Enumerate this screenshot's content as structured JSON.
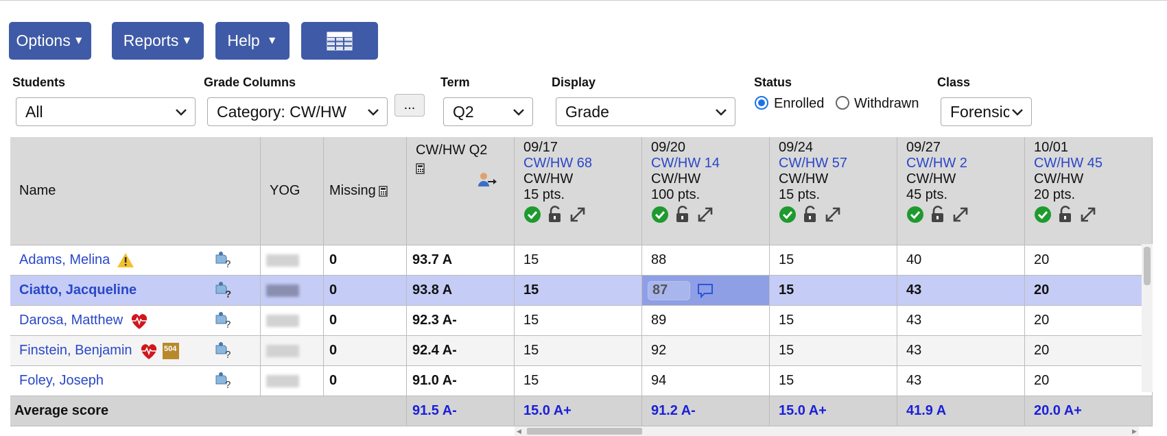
{
  "toolbar": {
    "options_label": "Options",
    "reports_label": "Reports",
    "help_label": "Help",
    "grid_view_icon": "grid-icon"
  },
  "filters": {
    "students_label": "Students",
    "students_value": "All",
    "grade_columns_label": "Grade Columns",
    "grade_columns_value": "Category: CW/HW",
    "more_label": "...",
    "term_label": "Term",
    "term_value": "Q2",
    "display_label": "Display",
    "display_value": "Grade",
    "status_label": "Status",
    "status_enrolled": "Enrolled",
    "status_withdrawn": "Withdrawn",
    "class_label": "Class",
    "class_value": "Forensic"
  },
  "grid": {
    "headers": {
      "name": "Name",
      "yog": "YOG",
      "missing": "Missing",
      "term_avg": "CW/HW Q2"
    },
    "assignments": [
      {
        "date": "09/17",
        "title": "CW/HW 68",
        "category": "CW/HW",
        "points": "15 pts."
      },
      {
        "date": "09/20",
        "title": "CW/HW 14",
        "category": "CW/HW",
        "points": "100 pts."
      },
      {
        "date": "09/24",
        "title": "CW/HW 57",
        "category": "CW/HW",
        "points": "15 pts."
      },
      {
        "date": "09/27",
        "title": "CW/HW 2",
        "category": "CW/HW",
        "points": "45 pts."
      },
      {
        "date": "10/01",
        "title": "CW/HW 45",
        "category": "CW/HW",
        "points": "20 pts."
      }
    ],
    "rows": [
      {
        "name": "Adams, Melina",
        "flags": [
          "warning-icon"
        ],
        "missing": "0",
        "avg": "93.7 A",
        "scores": [
          "15",
          "88",
          "15",
          "40",
          "20"
        ]
      },
      {
        "name": "Ciatto, Jacqueline",
        "flags": [],
        "missing": "0",
        "avg": "93.8 A",
        "scores": [
          "15",
          "87",
          "15",
          "43",
          "20"
        ],
        "selected": true
      },
      {
        "name": "Darosa, Matthew",
        "flags": [
          "health-heart-icon"
        ],
        "missing": "0",
        "avg": "92.3 A-",
        "scores": [
          "15",
          "89",
          "15",
          "43",
          "20"
        ]
      },
      {
        "name": "Finstein, Benjamin",
        "flags": [
          "health-heart-icon",
          "504-plan-icon"
        ],
        "missing": "0",
        "avg": "92.4 A-",
        "scores": [
          "15",
          "92",
          "15",
          "43",
          "20"
        ]
      },
      {
        "name": "Foley, Joseph",
        "flags": [],
        "missing": "0",
        "avg": "91.0 A-",
        "scores": [
          "15",
          "94",
          "15",
          "43",
          "20"
        ]
      }
    ],
    "average": {
      "label": "Average score",
      "avg": "91.5 A-",
      "scores": [
        "15.0 A+",
        "91.2 A-",
        "15.0 A+",
        "41.9 A",
        "20.0 A+"
      ]
    },
    "badge_504": "504"
  },
  "colors": {
    "button_bg": "#3f5aa6",
    "link": "#2a47c8",
    "selected_row": "#c5cdf6",
    "avg_text": "#1a1fd8",
    "check_green": "#1e9a2e"
  }
}
